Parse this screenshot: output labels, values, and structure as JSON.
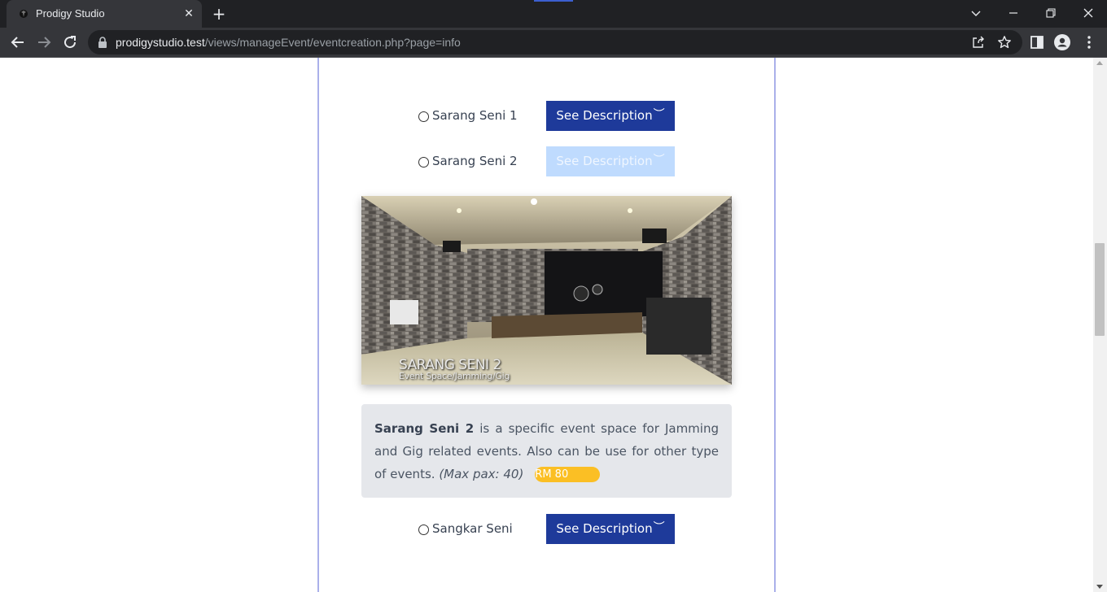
{
  "browser": {
    "tab_title": "Prodigy Studio",
    "new_tab_symbol": "+",
    "close_tab_symbol": "✕",
    "url_host": "prodigystudio.test",
    "url_path": "/views/manageEvent/eventcreation.php?page=info",
    "icons": [
      "back-icon",
      "forward-icon",
      "reload-icon",
      "lock-icon",
      "share-icon",
      "star-icon",
      "sidepanel-icon",
      "profile-icon",
      "menu-icon",
      "minimize-icon",
      "restore-icon",
      "close-icon",
      "tab-search-icon"
    ]
  },
  "venues": [
    {
      "name": "Sarang Seni 1",
      "button_label": "See Description",
      "chevron": "︶",
      "expanded": false
    },
    {
      "name": "Sarang Seni 2",
      "button_label": "See Description",
      "chevron": "︶",
      "expanded": true
    },
    {
      "name": "Sangkar Seni",
      "button_label": "See Description",
      "chevron": "︶",
      "expanded": false
    }
  ],
  "expanded_venue": {
    "image_caption_title": "SARANG SENI 2",
    "image_caption_subtitle": "Event Space/Jamming/Gig",
    "description_bold": "Sarang Seni 2",
    "description_text": " is a specific event space for Jamming and Gig related events. Also can be use for other type of events.",
    "max_pax": "(Max pax: 40)",
    "price": "RM 80"
  },
  "colors": {
    "button_primary": "#1e3a9a",
    "button_active": "#bfdbfe",
    "price_badge": "#fbbf24",
    "description_bg": "#e5e7eb",
    "card_border": "#aab0ea"
  }
}
